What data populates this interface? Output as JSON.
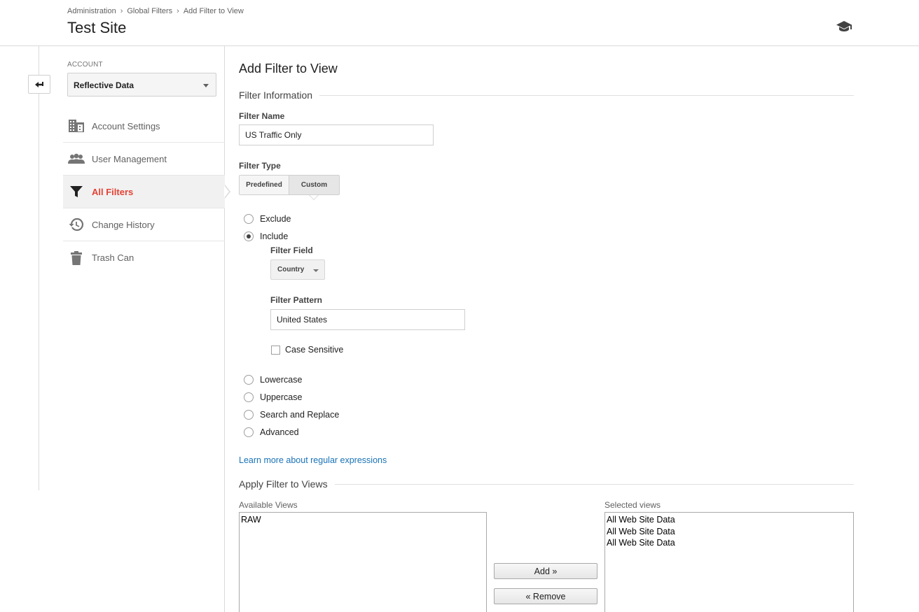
{
  "header": {
    "breadcrumb": [
      "Administration",
      "Global Filters",
      "Add Filter to View"
    ],
    "breadcrumb_sep": "›",
    "title": "Test Site",
    "help_icon": "graduation-cap-icon"
  },
  "nav": {
    "back_icon": "back-arrow-icon",
    "account_label": "ACCOUNT",
    "account_value": "Reflective Data",
    "items": [
      {
        "label": "Account Settings",
        "icon": "building-icon"
      },
      {
        "label": "User Management",
        "icon": "people-icon"
      },
      {
        "label": "All Filters",
        "icon": "filter-icon",
        "active": true
      },
      {
        "label": "Change History",
        "icon": "history-icon"
      },
      {
        "label": "Trash Can",
        "icon": "trash-icon"
      }
    ],
    "active_color": "#e34234"
  },
  "form": {
    "title": "Add Filter to View",
    "section_info": "Filter Information",
    "filter_name_label": "Filter Name",
    "filter_name_value": "US Traffic Only",
    "filter_type_label": "Filter Type",
    "type_predefined": "Predefined",
    "type_custom": "Custom",
    "selected_type": "Custom",
    "options": {
      "exclude": "Exclude",
      "include": "Include",
      "lowercase": "Lowercase",
      "uppercase": "Uppercase",
      "search_replace": "Search and Replace",
      "advanced": "Advanced"
    },
    "selected_option": "Include",
    "filter_field_label": "Filter Field",
    "filter_field_value": "Country",
    "filter_pattern_label": "Filter Pattern",
    "filter_pattern_value": "United States",
    "case_sensitive_label": "Case Sensitive",
    "case_sensitive_checked": false,
    "regex_link": "Learn more about regular expressions",
    "link_color": "#1a73b8"
  },
  "apply": {
    "section": "Apply Filter to Views",
    "available_label": "Available Views",
    "available": [
      "RAW"
    ],
    "selected_label": "Selected views",
    "selected": [
      "All Web Site Data",
      "All Web Site Data",
      "All Web Site Data"
    ],
    "add_button": "Add »",
    "remove_button": "« Remove"
  }
}
